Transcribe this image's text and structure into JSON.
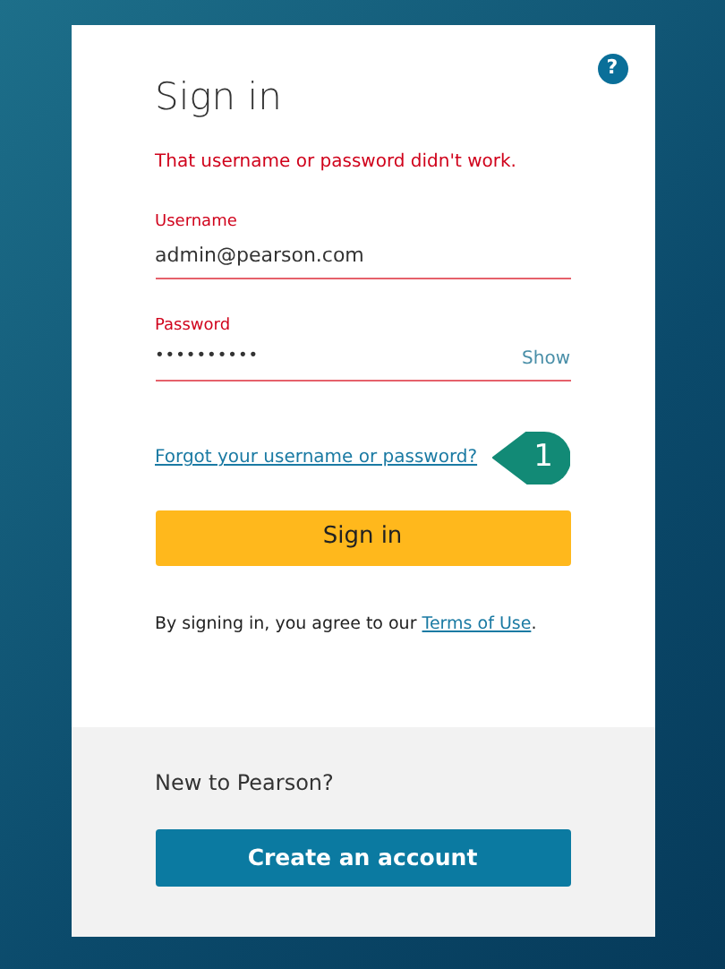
{
  "help_button": "?",
  "title": "Sign in",
  "error_message": "That username or password didn't work.",
  "fields": [
    {
      "kind": "text",
      "label": "Username",
      "value": "admin@pearson.com",
      "error": true
    },
    {
      "kind": "password",
      "label": "Password",
      "value": "••••••••••",
      "error": true,
      "toggle": "Show"
    }
  ],
  "forgot_link": "Forgot your username or password?",
  "callout": "1",
  "sign_in_button": "Sign in",
  "terms": {
    "text": "By signing in, you agree to our ",
    "link": "Terms of Use",
    "end": "."
  },
  "new_prompt": "New to Pearson?",
  "create_button": "Create an account"
}
